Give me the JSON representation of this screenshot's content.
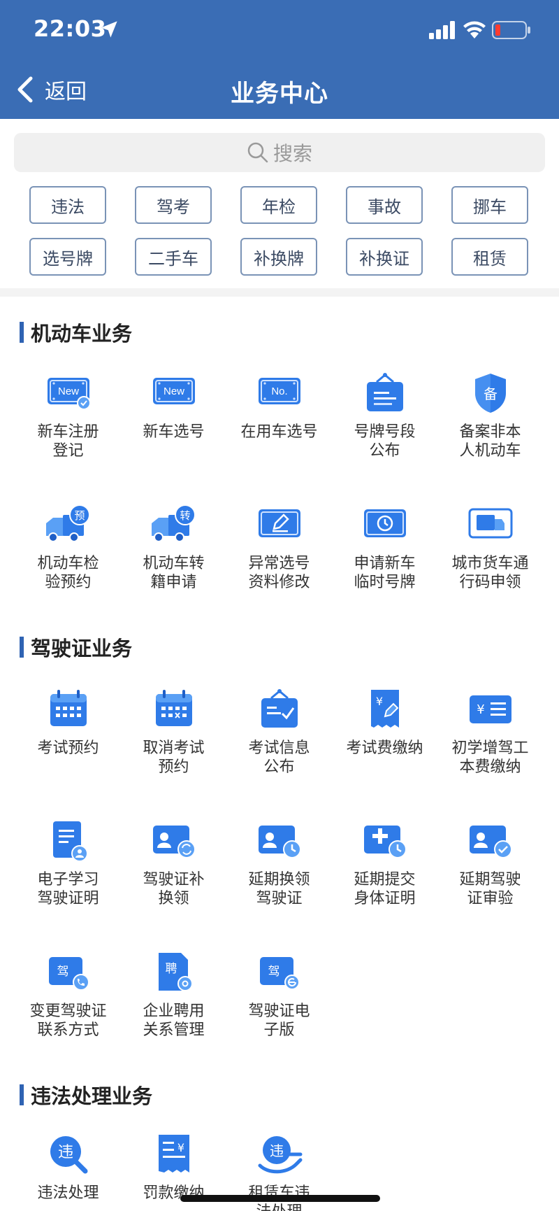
{
  "status": {
    "time": "22:03"
  },
  "nav": {
    "back_label": "返回",
    "title": "业务中心"
  },
  "search": {
    "placeholder": "搜索"
  },
  "chips": [
    "违法",
    "驾考",
    "年检",
    "事故",
    "挪车",
    "选号牌",
    "二手车",
    "补换牌",
    "补换证",
    "租赁"
  ],
  "sections": [
    {
      "title": "机动车业务",
      "items": [
        {
          "label": "新车注册\n登记",
          "icon": "new-car-register-icon"
        },
        {
          "label": "新车选号",
          "icon": "new-plate-icon"
        },
        {
          "label": "在用车选号",
          "icon": "number-plate-icon"
        },
        {
          "label": "号牌号段\n公布",
          "icon": "plate-notice-icon"
        },
        {
          "label": "备案非本\n人机动车",
          "icon": "record-shield-icon"
        },
        {
          "label": "机动车检\n验预约",
          "icon": "truck-appointment-icon"
        },
        {
          "label": "机动车转\n籍申请",
          "icon": "truck-transfer-icon"
        },
        {
          "label": "异常选号\n资料修改",
          "icon": "edit-card-icon"
        },
        {
          "label": "申请新车\n临时号牌",
          "icon": "temporary-plate-icon"
        },
        {
          "label": "城市货车通\n行码申领",
          "icon": "cargo-truck-icon"
        }
      ]
    },
    {
      "title": "驾驶证业务",
      "items": [
        {
          "label": "考试预约",
          "icon": "calendar-icon"
        },
        {
          "label": "取消考试\n预约",
          "icon": "calendar-cancel-icon"
        },
        {
          "label": "考试信息\n公布",
          "icon": "notice-board-icon"
        },
        {
          "label": "考试费缴纳",
          "icon": "fee-receipt-icon"
        },
        {
          "label": "初学增驾工\n本费缴纳",
          "icon": "fee-card-icon"
        },
        {
          "label": "电子学习\n驾驶证明",
          "icon": "e-document-icon"
        },
        {
          "label": "驾驶证补\n换领",
          "icon": "license-refresh-icon"
        },
        {
          "label": "延期换领\n驾驶证",
          "icon": "license-clock-icon"
        },
        {
          "label": "延期提交\n身体证明",
          "icon": "medical-clock-icon"
        },
        {
          "label": "延期驾驶\n证审验",
          "icon": "license-check-icon"
        },
        {
          "label": "变更驾驶证\n联系方式",
          "icon": "license-phone-icon"
        },
        {
          "label": "企业聘用\n关系管理",
          "icon": "employment-gear-icon"
        },
        {
          "label": "驾驶证电\n子版",
          "icon": "e-license-icon"
        }
      ]
    },
    {
      "title": "违法处理业务",
      "items": [
        {
          "label": "违法处理",
          "icon": "violation-search-icon"
        },
        {
          "label": "罚款缴纳",
          "icon": "fine-receipt-icon"
        },
        {
          "label": "租赁车违\n法处理",
          "icon": "rental-violation-icon"
        }
      ]
    }
  ],
  "section_chars": {
    "new": "New",
    "no": "No.",
    "yu": "预",
    "zhuan": "转",
    "bei": "备",
    "yuan": "¥",
    "jia": "驾",
    "pin": "聘",
    "wei": "违"
  },
  "colors": {
    "header": "#3a6db5",
    "icon_blue": "#2f7be8",
    "icon_light": "#5aa0f5"
  }
}
